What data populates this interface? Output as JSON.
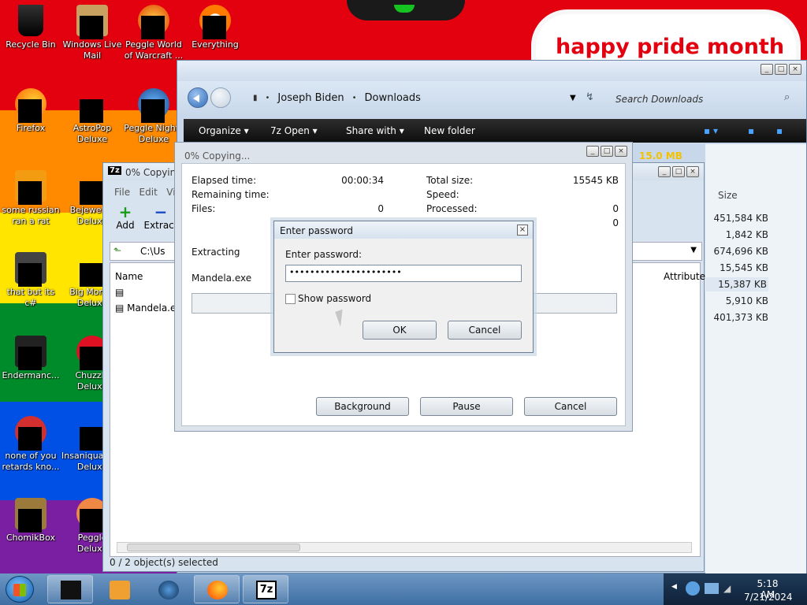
{
  "desktop": {
    "banner_text": "happy pride month",
    "icons": [
      {
        "label": "Recycle Bin"
      },
      {
        "label": "Windows Live Mail"
      },
      {
        "label": "Peggle World of Warcraft ..."
      },
      {
        "label": "Everything"
      },
      {
        "label": "Firefox"
      },
      {
        "label": "AstroPop Deluxe"
      },
      {
        "label": "Peggle Nights Deluxe"
      },
      {
        "label": "some russian ran a rat"
      },
      {
        "label": "Bejeweled Deluxe"
      },
      {
        "label": "that but its c#"
      },
      {
        "label": "Big Money Deluxe"
      },
      {
        "label": "Endermanc..."
      },
      {
        "label": "Chuzzle Deluxe"
      },
      {
        "label": "none of you retards kno..."
      },
      {
        "label": "Insaniquarium Deluxe"
      },
      {
        "label": "ChomikBox"
      },
      {
        "label": "Peggle Deluxe"
      }
    ]
  },
  "explorer": {
    "breadcrumb": [
      "Joseph Biden",
      "Downloads"
    ],
    "search_placeholder": "Search Downloads",
    "toolbar": {
      "organize": "Organize",
      "open": "Open",
      "share": "Share with",
      "new_folder": "New folder"
    },
    "selected_size": "15.0 MB",
    "size_header": "Size",
    "sizes": [
      "451,584 KB",
      "1,842 KB",
      "674,696 KB",
      "15,545 KB",
      "15,387 KB",
      "5,910 KB",
      "401,373 KB"
    ]
  },
  "sevenzip": {
    "title": "0% Copying...",
    "menu": [
      "File",
      "Edit",
      "Vi"
    ],
    "tools": {
      "add": "Add",
      "extract": "Extract"
    },
    "path": "C:\\Us",
    "columns": {
      "name": "Name",
      "attributes": "Attribute"
    },
    "files": [
      "",
      "Mandela.exe"
    ],
    "status": "0 / 2 object(s) selected"
  },
  "copy_dialog": {
    "title": "0% Copying...",
    "elapsed_label": "Elapsed time:",
    "elapsed_value": "00:00:34",
    "remaining_label": "Remaining time:",
    "files_label": "Files:",
    "files_value": "0",
    "total_size_label": "Total size:",
    "total_size_value": "15545 KB",
    "speed_label": "Speed:",
    "processed_label": "Processed:",
    "processed_value": "0",
    "compressed_value": "0",
    "operation": "Extracting",
    "current_file": "Mandela.exe",
    "progress": 0,
    "buttons": {
      "background": "Background",
      "pause": "Pause",
      "cancel": "Cancel"
    }
  },
  "password_dialog": {
    "title": "Enter password",
    "label": "Enter password:",
    "value": "••••••••••••••••••••••",
    "show_password": "Show password",
    "ok": "OK",
    "cancel": "Cancel"
  },
  "taskbar": {
    "time": "5:18 AM",
    "date": "7/21/2024"
  },
  "colors": {
    "pride_red": "#e3000f",
    "size_label": "#f2c200"
  }
}
